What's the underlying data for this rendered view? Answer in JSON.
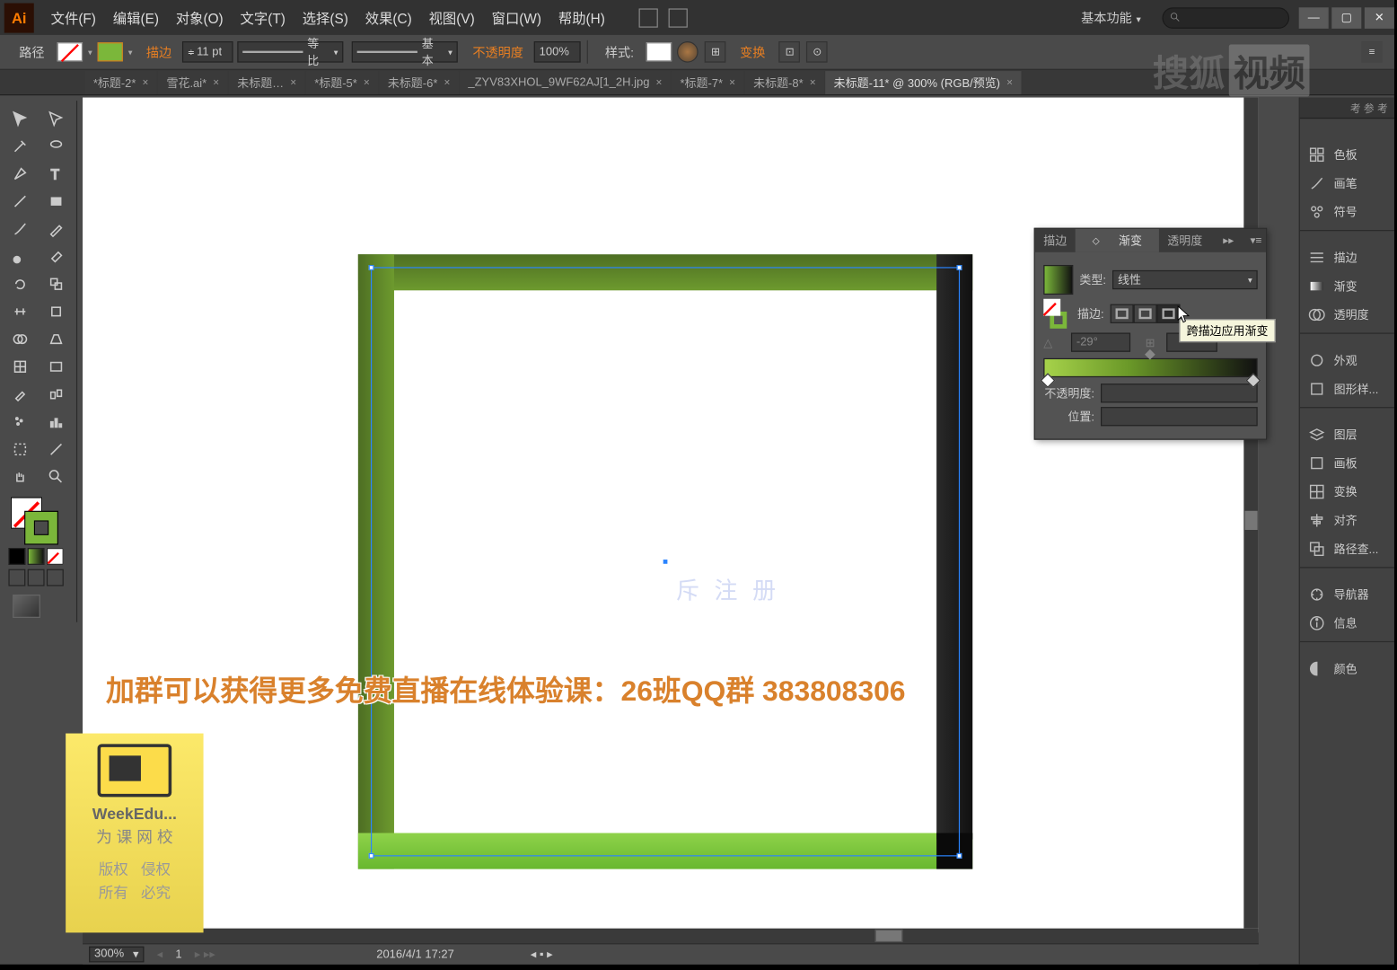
{
  "menu": {
    "items": [
      "文件(F)",
      "编辑(E)",
      "对象(O)",
      "文字(T)",
      "选择(S)",
      "效果(C)",
      "视图(V)",
      "窗口(W)",
      "帮助(H)"
    ]
  },
  "workspace": "基本功能",
  "control": {
    "selection_type": "路径",
    "stroke_label": "描边",
    "stroke_width": "11 pt",
    "dash_profile": "等比",
    "brush_profile": "基本",
    "opacity_label": "不透明度",
    "opacity_value": "100%",
    "style_label": "样式:",
    "transform_label": "变换"
  },
  "tabs": [
    {
      "label": "*标题-2*"
    },
    {
      "label": "雪花.ai*"
    },
    {
      "label": "未标题…"
    },
    {
      "label": "*标题-5*"
    },
    {
      "label": "未标题-6*"
    },
    {
      "label": "_ZYV83XHOL_9WF62AJ[1_2H.jpg"
    },
    {
      "label": "*标题-7*"
    },
    {
      "label": "未标题-8*"
    },
    {
      "label": "未标题-11* @ 300% (RGB/预览)",
      "active": true
    }
  ],
  "gradient_panel": {
    "tabs": [
      "描边",
      "渐变",
      "透明度"
    ],
    "active_tab": "渐变",
    "type_label": "类型:",
    "type_value": "线性",
    "stroke_label": "描边:",
    "tooltip": "跨描边应用渐变",
    "angle_value": "-29°",
    "opacity_label": "不透明度:",
    "location_label": "位置:"
  },
  "right_panels": {
    "guide": "考 参 考",
    "items1": [
      "色板",
      "画笔",
      "符号"
    ],
    "items2": [
      "描边",
      "渐变",
      "透明度"
    ],
    "items3": [
      "外观",
      "图形样..."
    ],
    "items4": [
      "图层",
      "画板",
      "变换",
      "对齐",
      "路径查..."
    ],
    "items5": [
      "导航器",
      "信息"
    ],
    "items6": [
      "颜色"
    ]
  },
  "status": {
    "zoom": "300%",
    "page": "1",
    "datetime": "2016/4/1  17:27"
  },
  "promo": {
    "line": "加群可以获得更多免费直播在线体验课：26班QQ群    383808306"
  },
  "badge": {
    "brand": "WeekEdu...",
    "sub": "为 课 网 校",
    "cells": [
      "版权",
      "侵权",
      "所有",
      "必究"
    ]
  },
  "canvas": {
    "faint_text": "斥 注 册"
  },
  "watermark": {
    "left": "搜狐",
    "right": "视频"
  }
}
